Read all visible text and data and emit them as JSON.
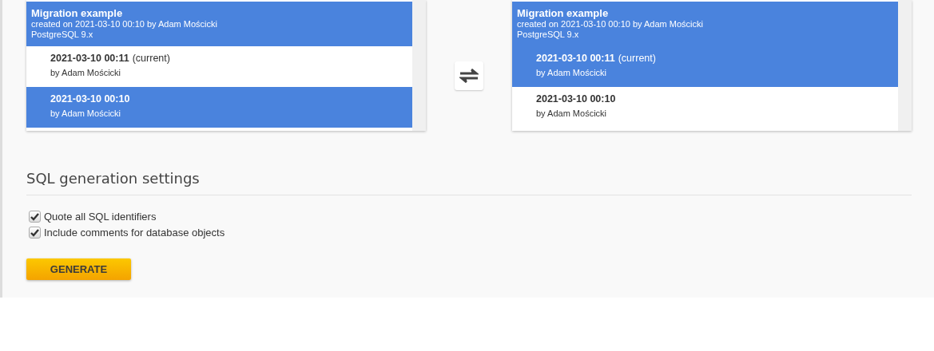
{
  "comparisons": [
    {
      "header": {
        "title": "Migration example",
        "created": "created on 2021-03-10 00:10 by Adam Mościcki",
        "database": "PostgreSQL 9.x",
        "selected": true
      },
      "versions": [
        {
          "date": "2021-03-10 00:11",
          "note": "(current)",
          "author": "by Adam Mościcki",
          "selected": false
        },
        {
          "date": "2021-03-10 00:10",
          "author": "by Adam Mościcki",
          "selected": true
        }
      ]
    },
    {
      "header": {
        "title": "Migration example",
        "created": "created on 2021-03-10 00:10 by Adam Mościcki",
        "database": "PostgreSQL 9.x",
        "selected": true
      },
      "versions": [
        {
          "date": "2021-03-10 00:11",
          "note": "(current)",
          "author": "by Adam Mościcki",
          "selected": true
        },
        {
          "date": "2021-03-10 00:10",
          "author": "by Adam Mościcki",
          "selected": false
        }
      ]
    }
  ],
  "settings": {
    "title": "SQL generation settings",
    "options": [
      {
        "label": "Quote all SQL identifiers",
        "checked": true
      },
      {
        "label": "Include comments for database objects",
        "checked": true
      }
    ]
  },
  "generate_button": "GENERATE"
}
